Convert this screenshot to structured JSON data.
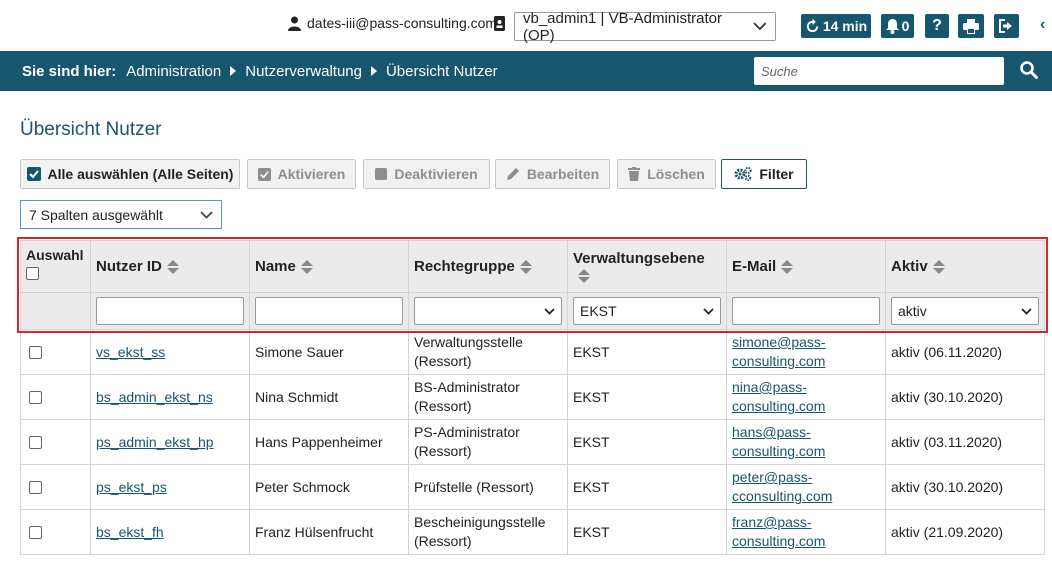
{
  "header": {
    "user_email": "dates-iii@pass-consulting.com",
    "role_select_value": "vb_admin1 | VB-Administrator (OP)",
    "session_timer": "14 min",
    "notifications_count": "0",
    "help_label": "?",
    "accent_color": "#17566f"
  },
  "nav": {
    "lead": "Sie sind hier:",
    "breadcrumbs": [
      "Administration",
      "Nutzerverwaltung",
      "Übersicht Nutzer"
    ],
    "search_placeholder": "Suche"
  },
  "page": {
    "title": "Übersicht Nutzer"
  },
  "actions": {
    "select_all": "Alle auswählen (Alle Seiten)",
    "activate": "Aktivieren",
    "deactivate": "Deaktivieren",
    "edit": "Bearbeiten",
    "delete": "Löschen",
    "filter": "Filter"
  },
  "columns_select": "7 Spalten ausgewählt",
  "table": {
    "headers": {
      "select": "Auswahl",
      "user_id": "Nutzer ID",
      "name": "Name",
      "group": "Rechtegruppe",
      "level": "Verwaltungsebene",
      "email": "E-Mail",
      "active": "Aktiv"
    },
    "filters": {
      "level": "EKST",
      "active": "aktiv"
    },
    "rows": [
      {
        "id": "vs_ekst_ss",
        "name": "Simone Sauer",
        "group_1": "Verwaltungsstelle",
        "group_2": "(Ressort)",
        "level": "EKST",
        "email_1": "simone@pass-",
        "email_2": "consulting.com",
        "active": "aktiv (06.11.2020)"
      },
      {
        "id": "bs_admin_ekst_ns",
        "name": "Nina Schmidt",
        "group_1": "BS-Administrator",
        "group_2": "(Ressort)",
        "level": "EKST",
        "email_1": "nina@pass-",
        "email_2": "consulting.com",
        "active": "aktiv (30.10.2020)"
      },
      {
        "id": "ps_admin_ekst_hp",
        "name": "Hans Pappenheimer",
        "group_1": "PS-Administrator",
        "group_2": "(Ressort)",
        "level": "EKST",
        "email_1": "hans@pass-",
        "email_2": "consulting.com",
        "active": "aktiv (03.11.2020)"
      },
      {
        "id": "ps_ekst_ps",
        "name": "Peter Schmock",
        "group_1": "Prüfstelle (Ressort)",
        "group_2": "",
        "level": "EKST",
        "email_1": "peter@pass-",
        "email_2": "cconsulting.com",
        "active": "aktiv (30.10.2020)"
      },
      {
        "id": "bs_ekst_fh",
        "name": "Franz Hülsenfrucht",
        "group_1": "Bescheinigungsstelle",
        "group_2": "(Ressort)",
        "level": "EKST",
        "email_1": "franz@pass-",
        "email_2": "consulting.com",
        "active": "aktiv (21.09.2020)"
      }
    ]
  }
}
